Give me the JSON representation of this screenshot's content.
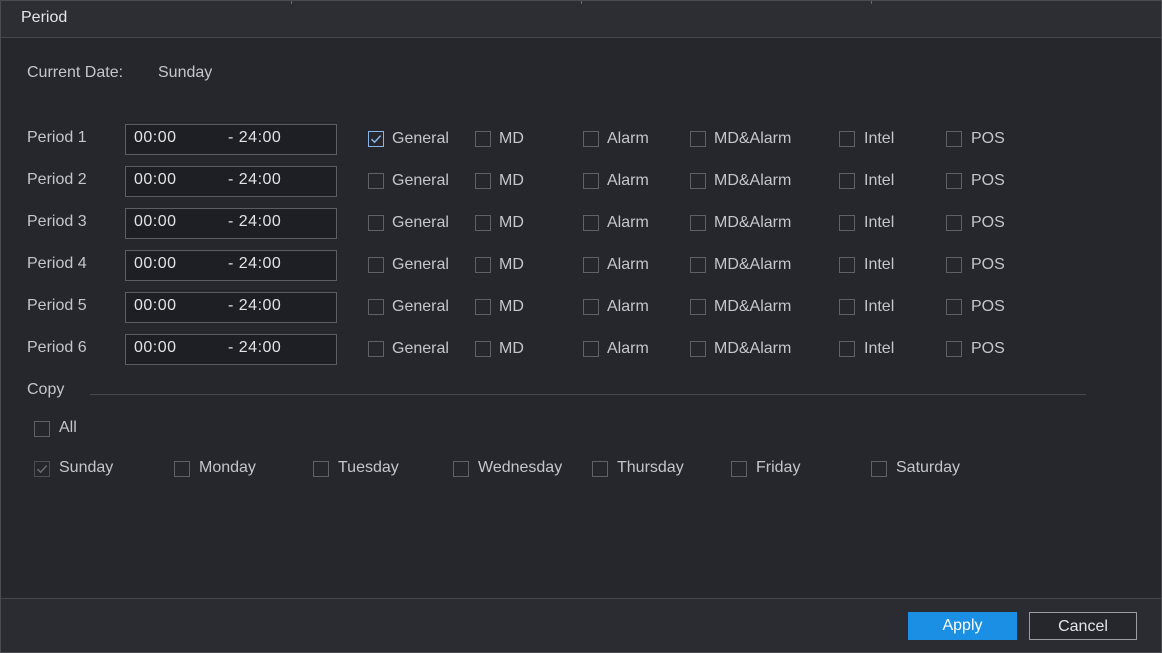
{
  "dialog": {
    "title": "Period"
  },
  "current_date": {
    "label": "Current Date:",
    "value": "Sunday"
  },
  "periods": [
    {
      "label": "Period 1",
      "start": "00:00",
      "end": "- 24:00",
      "general": true
    },
    {
      "label": "Period 2",
      "start": "00:00",
      "end": "- 24:00",
      "general": false
    },
    {
      "label": "Period 3",
      "start": "00:00",
      "end": "- 24:00",
      "general": false
    },
    {
      "label": "Period 4",
      "start": "00:00",
      "end": "- 24:00",
      "general": false
    },
    {
      "label": "Period 5",
      "start": "00:00",
      "end": "- 24:00",
      "general": false
    },
    {
      "label": "Period 6",
      "start": "00:00",
      "end": "- 24:00",
      "general": false
    }
  ],
  "record_types": [
    "General",
    "MD",
    "Alarm",
    "MD&Alarm",
    "Intel",
    "POS"
  ],
  "copy": {
    "label": "Copy",
    "all_label": "All",
    "days": [
      "Sunday",
      "Monday",
      "Tuesday",
      "Wednesday",
      "Thursday",
      "Friday",
      "Saturday"
    ]
  },
  "footer": {
    "apply_label": "Apply",
    "cancel_label": "Cancel"
  },
  "colors": {
    "accent": "#1a8fe3",
    "background": "#25272d",
    "check": "#8ab4e8"
  }
}
